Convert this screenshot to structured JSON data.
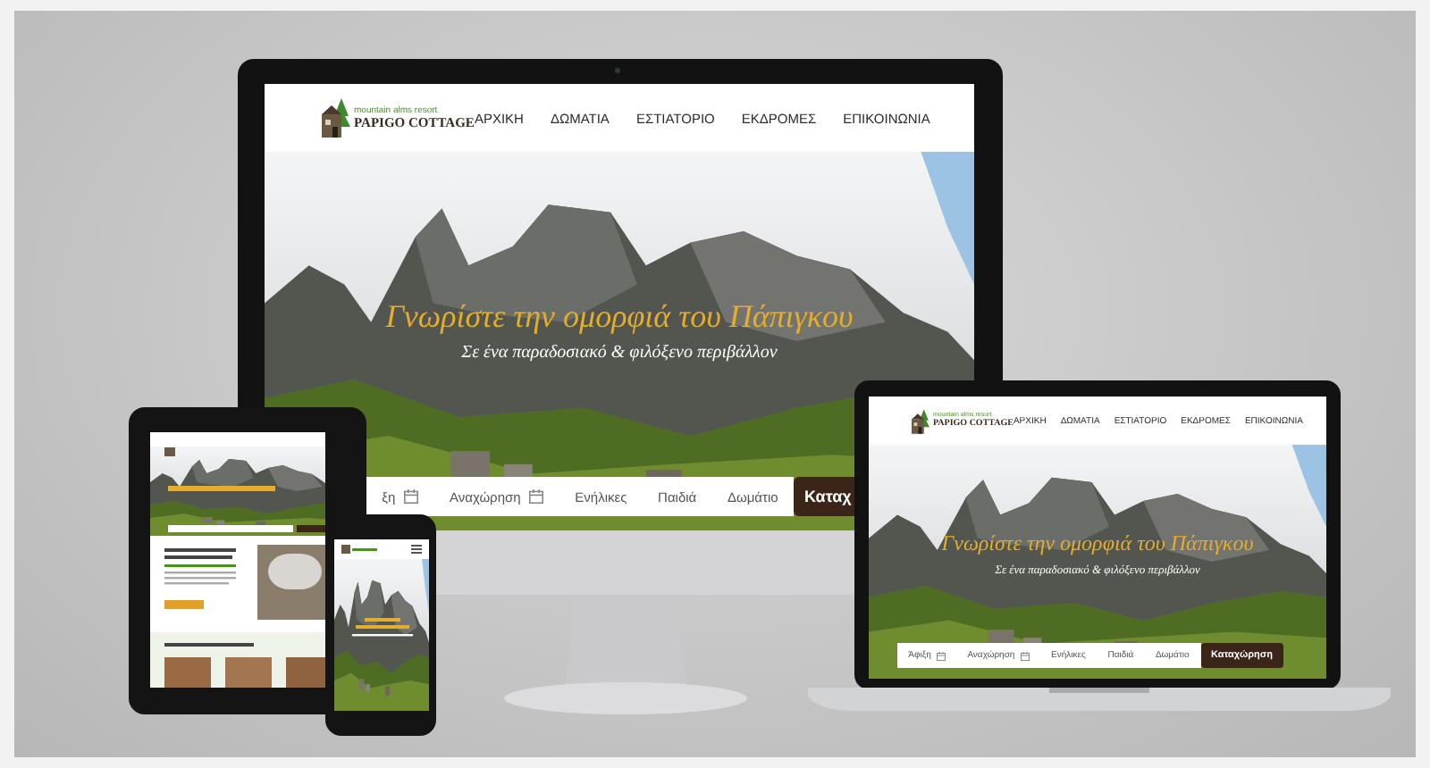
{
  "desktop": {
    "logo": {
      "tagline": "mountain alms resort",
      "name": "PAPIGO COTTAGE"
    },
    "nav": [
      "ΑΡΧΙΚΗ",
      "ΔΩΜΑΤΙΑ",
      "ΕΣΤΙΑΤΟΡΙΟ",
      "ΕΚΔΡΟΜΕΣ",
      "ΕΠΙΚΟΙΝΩΝΙΑ"
    ],
    "hero": {
      "title": "Γνωρίστε την ομορφιά του Πάπιγκου",
      "subtitle": "Σε ένα παραδοσιακό & φιλόξενο περιβάλλον"
    },
    "booking": {
      "fields": [
        {
          "label": "ξη",
          "kind": "date"
        },
        {
          "label": "Αναχώρηση",
          "kind": "date"
        },
        {
          "label": "Ενήλικες",
          "kind": "select"
        },
        {
          "label": "Παιδιά",
          "kind": "select"
        },
        {
          "label": "Δωμάτιο",
          "kind": "select"
        }
      ],
      "button": "Καταχ"
    }
  },
  "laptop": {
    "logo": {
      "tagline": "mountain alms resort",
      "name": "PAPIGO COTTAGE"
    },
    "nav": [
      "ΑΡΧΙΚΗ",
      "ΔΩΜΑΤΙΑ",
      "ΕΣΤΙΑΤΟΡΙΟ",
      "ΕΚΔΡΟΜΕΣ",
      "ΕΠΙΚΟΙΝΩΝΙΑ"
    ],
    "hero": {
      "title": "Γνωρίστε την ομορφιά του Πάπιγκου",
      "subtitle": "Σε ένα παραδοσιακό & φιλόξενο περιβάλλον"
    },
    "booking": {
      "fields": [
        {
          "label": "Άφιξη",
          "kind": "date"
        },
        {
          "label": "Αναχώρηση",
          "kind": "date"
        },
        {
          "label": "Ενήλικες",
          "kind": "select"
        },
        {
          "label": "Παιδιά",
          "kind": "select"
        },
        {
          "label": "Δωμάτιο",
          "kind": "select"
        }
      ],
      "button": "Καταχώρηση"
    }
  }
}
